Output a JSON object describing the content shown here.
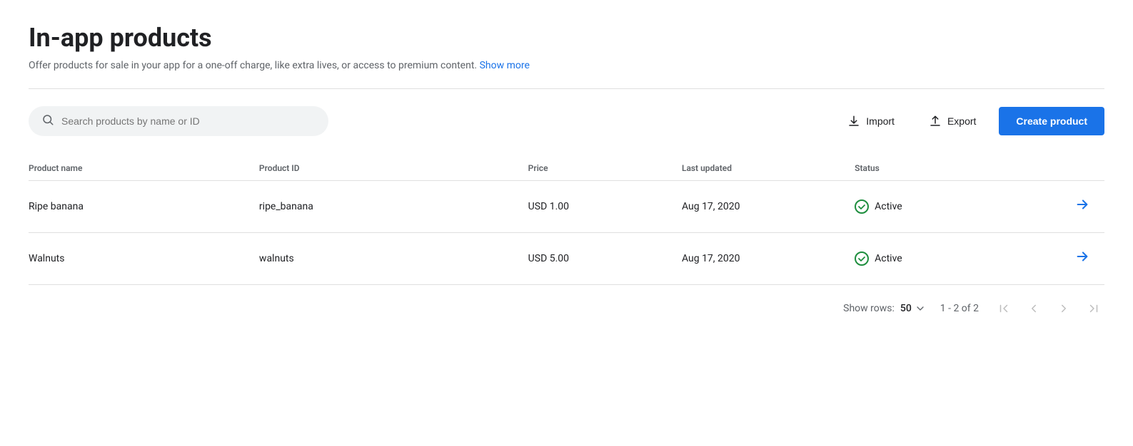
{
  "page": {
    "title": "In-app products",
    "subtitle": "Offer products for sale in your app for a one-off charge, like extra lives, or access to premium content.",
    "show_more_label": "Show more"
  },
  "toolbar": {
    "search_placeholder": "Search products by name or ID",
    "import_label": "Import",
    "export_label": "Export",
    "create_label": "Create product"
  },
  "table": {
    "columns": [
      {
        "key": "name",
        "label": "Product name"
      },
      {
        "key": "id",
        "label": "Product ID"
      },
      {
        "key": "price",
        "label": "Price"
      },
      {
        "key": "updated",
        "label": "Last updated"
      },
      {
        "key": "status",
        "label": "Status"
      },
      {
        "key": "action",
        "label": ""
      }
    ],
    "rows": [
      {
        "name": "Ripe banana",
        "id": "ripe_banana",
        "price": "USD 1.00",
        "updated": "Aug 17, 2020",
        "status": "Active"
      },
      {
        "name": "Walnuts",
        "id": "walnuts",
        "price": "USD 5.00",
        "updated": "Aug 17, 2020",
        "status": "Active"
      }
    ]
  },
  "pagination": {
    "show_rows_label": "Show rows:",
    "rows_per_page": "50",
    "range": "1 - 2 of 2"
  },
  "colors": {
    "active_green": "#1e8e3e",
    "primary_blue": "#1a73e8"
  }
}
